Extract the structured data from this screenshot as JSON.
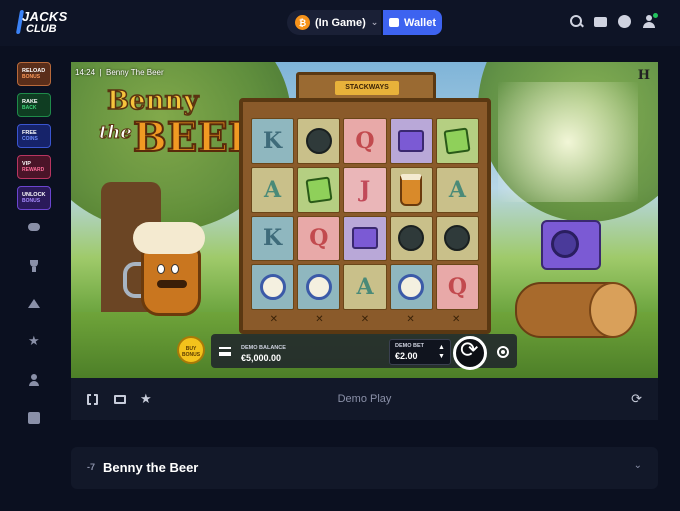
{
  "header": {
    "logo_line1": "JACKS",
    "logo_line2": "CLUB",
    "status_label": "(In Game)",
    "coin_symbol": "₿",
    "wallet_label": "Wallet"
  },
  "sidebar": {
    "promos": [
      {
        "title": "RELOAD",
        "sub": "BONUS"
      },
      {
        "title": "RAKE",
        "sub": "BACK"
      },
      {
        "title": "FREE",
        "sub": "COINS"
      },
      {
        "title": "VIP",
        "sub": "REWARD"
      },
      {
        "title": "UNLOCK",
        "sub": "BONUS"
      }
    ]
  },
  "game": {
    "time": "14:24",
    "name": "Benny The Beer",
    "h_logo": "H",
    "title_benny": "Benny",
    "title_the": "the",
    "title_beer": "BEER",
    "sign_label": "STACKWAYS",
    "reels": [
      [
        "K",
        "bomb",
        "Q",
        "camera",
        "box"
      ],
      [
        "A",
        "box",
        "J",
        "mug",
        "A"
      ],
      [
        "K",
        "Q",
        "camera",
        "bomb",
        "bomb"
      ],
      [
        "clock",
        "clock",
        "A",
        "clock",
        "Q"
      ]
    ],
    "reel_marks": [
      "✕",
      "✕",
      "✕",
      "✕",
      "✕"
    ],
    "buy_bonus": "BUY BONUS",
    "balance_label": "DEMO BALANCE",
    "balance_value": "€5,000.00",
    "bet_label": "DEMO BET",
    "bet_value": "€2.00"
  },
  "controls": {
    "demo_play": "Demo Play"
  },
  "info": {
    "icon_text": "-7",
    "title": "Benny the Beer"
  },
  "colors": {
    "accent": "#3d63f0",
    "background": "#0b1020",
    "panel": "#121829"
  }
}
